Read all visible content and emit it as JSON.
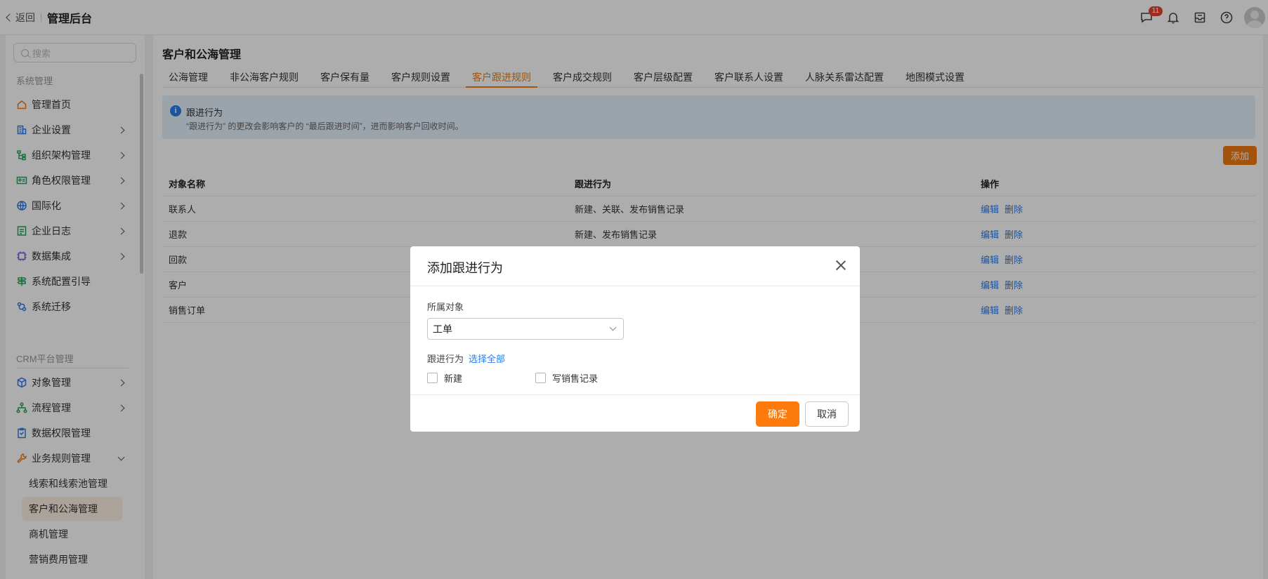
{
  "header": {
    "back_label": "返回",
    "app_title": "管理后台",
    "message_badge": "11",
    "icons": [
      "chat-icon",
      "bell-icon",
      "inbox-icon",
      "help-icon",
      "avatar"
    ]
  },
  "sidebar": {
    "search_placeholder": "搜索",
    "group1_title": "系统管理",
    "group1_items": [
      {
        "label": "管理首页",
        "icon": "home-icon",
        "has_arrow": false
      },
      {
        "label": "企业设置",
        "icon": "building-icon",
        "has_arrow": true
      },
      {
        "label": "组织架构管理",
        "icon": "org-icon",
        "has_arrow": true
      },
      {
        "label": "角色权限管理",
        "icon": "id-card-icon",
        "has_arrow": true
      },
      {
        "label": "国际化",
        "icon": "globe-icon",
        "has_arrow": true
      },
      {
        "label": "企业日志",
        "icon": "log-icon",
        "has_arrow": true
      },
      {
        "label": "数据集成",
        "icon": "chip-icon",
        "has_arrow": true
      },
      {
        "label": "系统配置引导",
        "icon": "signpost-icon",
        "has_arrow": false
      },
      {
        "label": "系统迁移",
        "icon": "migrate-icon",
        "has_arrow": false
      }
    ],
    "group2_title": "CRM平台管理",
    "group2_items": [
      {
        "label": "对象管理",
        "icon": "cube-icon",
        "has_arrow": true
      },
      {
        "label": "流程管理",
        "icon": "flow-icon",
        "has_arrow": true
      },
      {
        "label": "数据权限管理",
        "icon": "clipboard-icon",
        "has_arrow": false
      },
      {
        "label": "业务规则管理",
        "icon": "wrench-icon",
        "has_arrow": true
      }
    ],
    "sub_items": [
      {
        "label": "线索和线索池管理",
        "active": false
      },
      {
        "label": "客户和公海管理",
        "active": true
      },
      {
        "label": "商机管理",
        "active": false
      },
      {
        "label": "营销费用管理",
        "active": false
      }
    ]
  },
  "main": {
    "title": "客户和公海管理",
    "tabs": [
      {
        "label": "公海管理",
        "active": false
      },
      {
        "label": "非公海客户规则",
        "active": false
      },
      {
        "label": "客户保有量",
        "active": false
      },
      {
        "label": "客户规则设置",
        "active": false
      },
      {
        "label": "客户跟进规则",
        "active": true
      },
      {
        "label": "客户成交规则",
        "active": false
      },
      {
        "label": "客户层级配置",
        "active": false
      },
      {
        "label": "客户联系人设置",
        "active": false
      },
      {
        "label": "人脉关系雷达配置",
        "active": false
      },
      {
        "label": "地图模式设置",
        "active": false
      }
    ],
    "alert": {
      "title": "跟进行为",
      "description": "“跟进行为” 的更改会影响客户的 “最后跟进时间”，进而影响客户回收时间。"
    },
    "add_button": "添加",
    "table": {
      "headers": [
        "对象名称",
        "跟进行为",
        "操作"
      ],
      "rows": [
        {
          "name": "联系人",
          "behavior": "新建、关联、发布销售记录"
        },
        {
          "name": "退款",
          "behavior": "新建、发布销售记录"
        },
        {
          "name": "回款",
          "behavior": ""
        },
        {
          "name": "客户",
          "behavior": ""
        },
        {
          "name": "销售订单",
          "behavior": ""
        }
      ],
      "edit_label": "编辑",
      "delete_label": "删除"
    }
  },
  "modal": {
    "title": "添加跟进行为",
    "object_label": "所属对象",
    "object_value": "工单",
    "behavior_label": "跟进行为",
    "select_all": "选择全部",
    "options": [
      {
        "label": "新建",
        "checked": false
      },
      {
        "label": "写销售记录",
        "checked": false
      }
    ],
    "confirm": "确定",
    "cancel": "取消"
  },
  "colors": {
    "accent": "#f07b12",
    "link": "#2b7de9",
    "badge": "#e8432e",
    "alert_bg": "#e5f0fc"
  }
}
